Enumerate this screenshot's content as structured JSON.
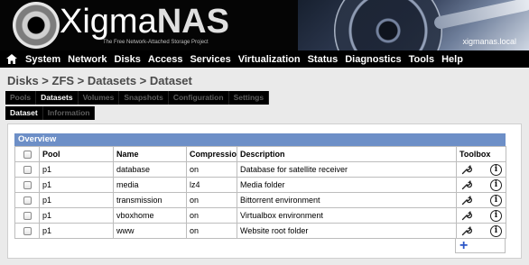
{
  "header": {
    "logo_main": "Xigma",
    "logo_accent": "NAS",
    "tagline": "The Free Network-Attached Storage Project",
    "hostname": "xigmanas.local"
  },
  "menu": {
    "home_icon": "home-icon",
    "items": [
      "System",
      "Network",
      "Disks",
      "Access",
      "Services",
      "Virtualization",
      "Status",
      "Diagnostics",
      "Tools",
      "Help"
    ]
  },
  "breadcrumb": "Disks > ZFS > Datasets > Dataset",
  "tabs": {
    "row1": [
      "Pools",
      "Datasets",
      "Volumes",
      "Snapshots",
      "Configuration",
      "Settings"
    ],
    "row1_active": "Datasets",
    "row2": [
      "Dataset",
      "Information"
    ],
    "row2_active": "Dataset"
  },
  "overview": {
    "title": "Overview",
    "columns": [
      "",
      "Pool",
      "Name",
      "Compression",
      "Description",
      "Toolbox"
    ],
    "rows": [
      {
        "pool": "p1",
        "name": "database",
        "compression": "on",
        "description": "Database for satellite receiver"
      },
      {
        "pool": "p1",
        "name": "media",
        "compression": "lz4",
        "description": "Media folder"
      },
      {
        "pool": "p1",
        "name": "transmission",
        "compression": "on",
        "description": "Bittorrent environment"
      },
      {
        "pool": "p1",
        "name": "vboxhome",
        "compression": "on",
        "description": "Virtualbox environment"
      },
      {
        "pool": "p1",
        "name": "www",
        "compression": "on",
        "description": "Website root folder"
      }
    ],
    "row_icons": [
      "wrench-icon",
      "info-icon"
    ],
    "add_icon": "plus-icon"
  },
  "colors": {
    "overview_bar": "#6d8fc7",
    "menu_bg": "#000000",
    "add_icon": "#2b56c7"
  }
}
